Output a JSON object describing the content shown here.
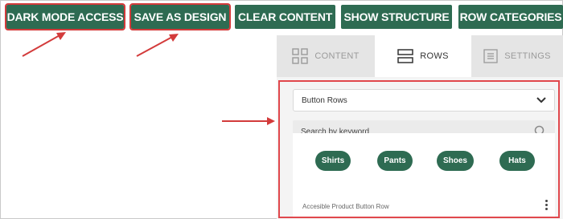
{
  "toolbar": {
    "buttons": [
      {
        "label": "DARK MODE ACCESS"
      },
      {
        "label": "SAVE AS DESIGN"
      },
      {
        "label": "CLEAR CONTENT"
      },
      {
        "label": "SHOW STRUCTURE"
      },
      {
        "label": "ROW CATEGORIES"
      }
    ]
  },
  "panel": {
    "tabs": [
      {
        "label": "CONTENT",
        "icon": "grid-icon",
        "active": false
      },
      {
        "label": "ROWS",
        "icon": "rows-icon",
        "active": true
      },
      {
        "label": "SETTINGS",
        "icon": "settings-icon",
        "active": false
      }
    ],
    "row_select": {
      "value": "Button Rows"
    },
    "search": {
      "placeholder": "Search by keyword"
    },
    "preview": {
      "buttons": [
        "Shirts",
        "Pants",
        "Shoes",
        "Hats"
      ],
      "caption": "Accesible Product Button Row"
    }
  },
  "colors": {
    "brand_green": "#2e6b52",
    "annotation_red": "#e0474c"
  }
}
